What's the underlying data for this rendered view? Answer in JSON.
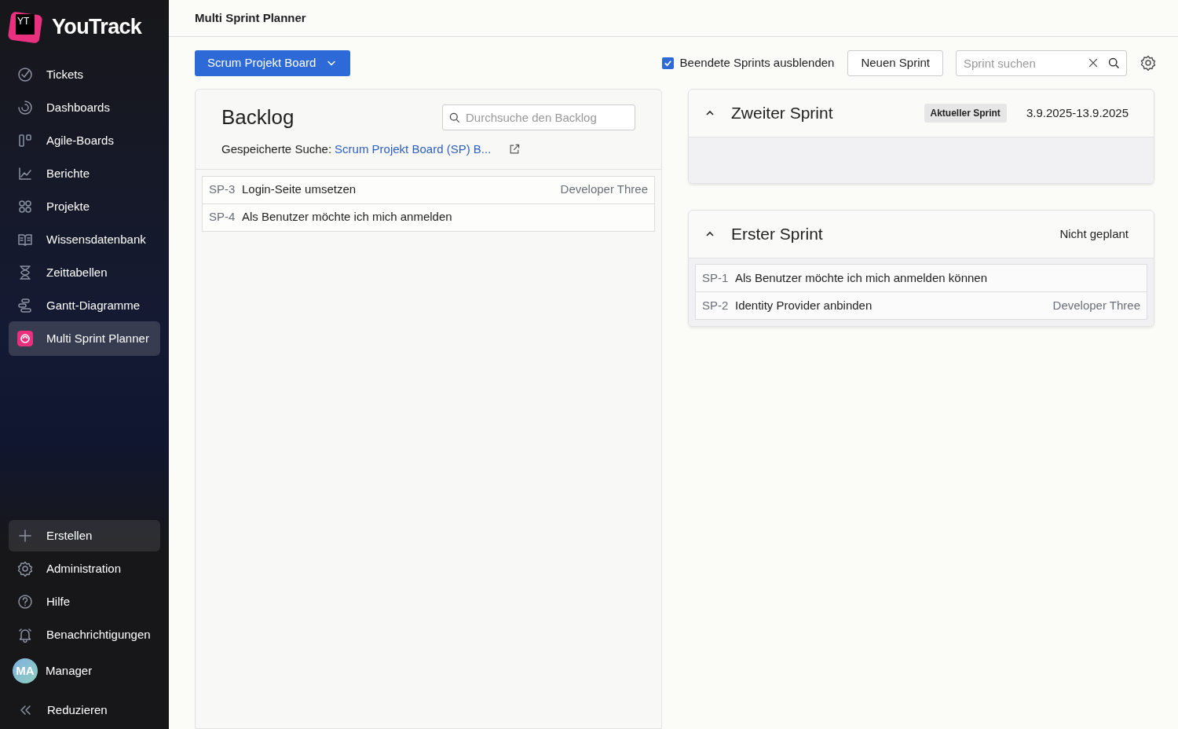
{
  "app": {
    "name": "YouTrack",
    "logo": "YT"
  },
  "sidebar": {
    "items": [
      {
        "label": "Tickets",
        "selected": false
      },
      {
        "label": "Dashboards",
        "selected": false
      },
      {
        "label": "Agile-Boards",
        "selected": false
      },
      {
        "label": "Berichte",
        "selected": false
      },
      {
        "label": "Projekte",
        "selected": false
      },
      {
        "label": "Wissensdatenbank",
        "selected": false
      },
      {
        "label": "Zeittabellen",
        "selected": false
      },
      {
        "label": "Gantt-Diagramme",
        "selected": false
      },
      {
        "label": "Multi Sprint Planner",
        "selected": true
      }
    ],
    "bottom_items": [
      {
        "label": "Erstellen",
        "highlighted": true
      },
      {
        "label": "Administration",
        "highlighted": false
      },
      {
        "label": "Hilfe",
        "highlighted": false
      },
      {
        "label": "Benachrichtigungen",
        "highlighted": false
      }
    ],
    "user": {
      "initials": "MA",
      "name": "Manager"
    },
    "collapse": "Reduzieren"
  },
  "page_title": "Multi Sprint Planner",
  "toolbar": {
    "board_button": "Scrum Projekt Board",
    "hide_finished": {
      "label": "Beendete Sprints ausblenden",
      "checked": true
    },
    "new_sprint": "Neuen Sprint",
    "search": {
      "placeholder": "Sprint suchen"
    }
  },
  "backlog": {
    "title": "Backlog",
    "search": {
      "placeholder": "Durchsuche den Backlog"
    },
    "saved_search_label": "Gespeicherte Suche:",
    "saved_search_link": "Scrum Projekt Board (SP) B...",
    "issues": [
      {
        "id": "SP-3",
        "summary": "Login-Seite umsetzen",
        "assignee": "Developer Three"
      },
      {
        "id": "SP-4",
        "summary": "Als Benutzer möchte ich mich anmelden"
      }
    ]
  },
  "sprints": [
    {
      "name": "Zweiter Sprint",
      "expanded": true,
      "badge": "Aktueller Sprint",
      "dates": "3.9.2025-13.9.2025"
    },
    {
      "name": "Erster Sprint",
      "expanded": true,
      "dates": "Nicht geplant",
      "issues": [
        {
          "id": "SP-1",
          "summary": "Als Benutzer möchte ich mich anmelden können"
        },
        {
          "id": "SP-2",
          "summary": "Identity Provider anbinden",
          "assignee": "Developer Three"
        }
      ]
    }
  ]
}
